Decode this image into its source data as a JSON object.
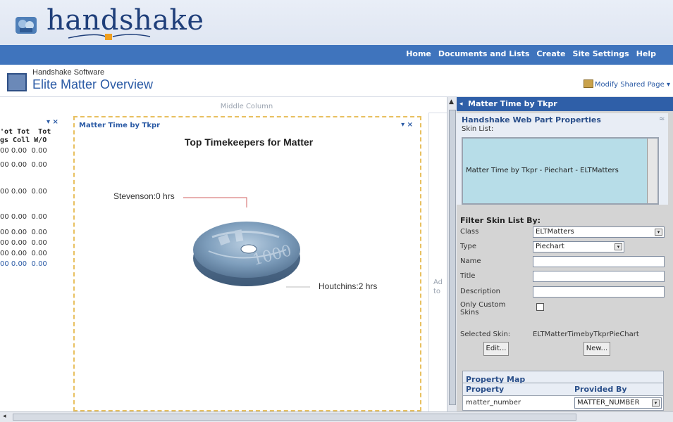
{
  "header": {
    "logo_text": "handshake"
  },
  "topnav": {
    "links": [
      "Home",
      "Documents and Lists",
      "Create",
      "Site Settings",
      "Help"
    ]
  },
  "titlebar": {
    "site_name": "Handshake Software",
    "page_title": "Elite Matter Overview",
    "modify_label": "Modify Shared Page ▾"
  },
  "left_column": {
    "header_lines": [
      "'ot Tot  Tot",
      "gs Coll W/O"
    ],
    "rows": [
      "00 0.00  0.00",
      "00 0.00  0.00",
      "00 0.00  0.00",
      "00 0.00  0.00",
      "00 0.00  0.00",
      "00 0.00  0.00",
      "00 0.00  0.00",
      "00 0.00  0.00"
    ],
    "controls": "▾ ×"
  },
  "middle_column": {
    "label": "Middle Column",
    "webpart_title": "Matter Time by Tkpr",
    "controls": "▾ ×",
    "chart_title": "Top Timekeepers for Matter",
    "adjacent_text": [
      "Ad",
      "to"
    ]
  },
  "chart_data": {
    "type": "pie",
    "title": "Top Timekeepers for Matter",
    "categories": [
      "Stevenson",
      "Houtchins"
    ],
    "values": [
      0,
      2
    ],
    "labels": [
      "Stevenson:0 hrs",
      "Houtchins:2 hrs"
    ]
  },
  "properties_pane": {
    "title": "Matter Time by Tkpr",
    "section_title": "Handshake Web Part Properties",
    "skin_list_label": "Skin List:",
    "skin_list_item": "Matter Time by Tkpr - Piechart - ELTMatters",
    "filter_title": "Filter Skin List By:",
    "fields": {
      "class_label": "Class",
      "class_value": "ELTMatters",
      "type_label": "Type",
      "type_value": "Piechart",
      "name_label": "Name",
      "title_label": "Title",
      "description_label": "Description",
      "only_custom_label": "Only Custom",
      "only_custom_label2": "Skins"
    },
    "selected_skin_label": "Selected Skin:",
    "selected_skin_value": "ELTMatterTimebyTkprPieChart",
    "edit_button": "Edit...",
    "new_button": "New...",
    "property_map": {
      "title": "Property Map",
      "col_property": "Property",
      "col_provided_by": "Provided By",
      "rows": [
        {
          "property": "matter_number",
          "provided_by": "MATTER_NUMBER"
        }
      ]
    }
  },
  "colors": {
    "nav_blue": "#3f74bd",
    "pane_title_blue": "#2f5fa8",
    "dashed_border": "#e8c060",
    "skin_list_bg": "#b7dde8"
  }
}
